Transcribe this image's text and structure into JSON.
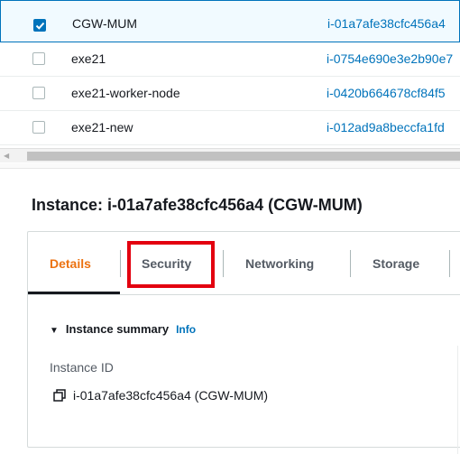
{
  "instances": [
    {
      "name": "CGW-MUM",
      "instance_id": "i-01a7afe38cfc456a4",
      "selected": true
    },
    {
      "name": "exe21",
      "instance_id": "i-0754e690e3e2b90e7",
      "selected": false
    },
    {
      "name": "exe21-worker-node",
      "instance_id": "i-0420b664678cf84f5",
      "selected": false
    },
    {
      "name": "exe21-new",
      "instance_id": "i-012ad9a8beccfa1fd",
      "selected": false
    }
  ],
  "detail": {
    "title": "Instance: i-01a7afe38cfc456a4 (CGW-MUM)",
    "tabs": [
      "Details",
      "Security",
      "Networking",
      "Storage"
    ],
    "active_tab": "Details",
    "summary_heading": "Instance summary",
    "info_link": "Info",
    "field_label": "Instance ID",
    "field_value": "i-01a7afe38cfc456a4 (CGW-MUM)"
  },
  "colors": {
    "accent": "#0073bb",
    "active_tab": "#ec7211",
    "highlight": "#e3000f"
  }
}
